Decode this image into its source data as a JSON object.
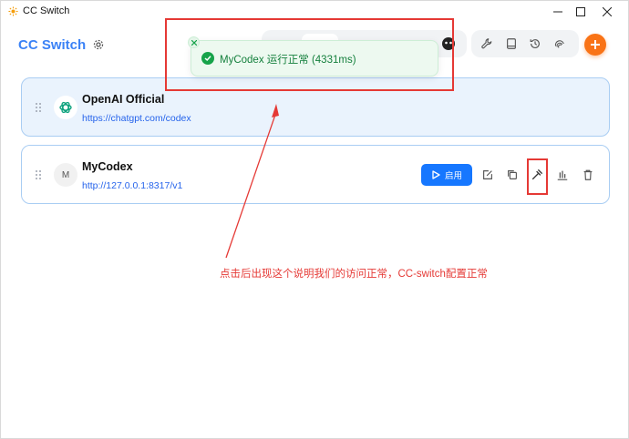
{
  "window": {
    "title": "CC Switch"
  },
  "header": {
    "brand": "CC Switch"
  },
  "toast": {
    "message": "MyCodex 运行正常 (4331ms)"
  },
  "providers": [
    {
      "name": "OpenAI Official",
      "url": "https://chatgpt.com/codex",
      "icon_label": "",
      "active": true
    },
    {
      "name": "MyCodex",
      "url": "http://127.0.0.1:8317/v1",
      "icon_label": "M",
      "active": false
    }
  ],
  "actions": {
    "enable_label": "启用"
  },
  "annotation": {
    "text": "点击后出现这个说明我们的访问正常，CC-switch配置正常"
  },
  "colors": {
    "brand": "#3b82f6",
    "accent": "#1677ff",
    "add": "#f97316",
    "success": "#16a34a",
    "annotation": "#e53935"
  }
}
